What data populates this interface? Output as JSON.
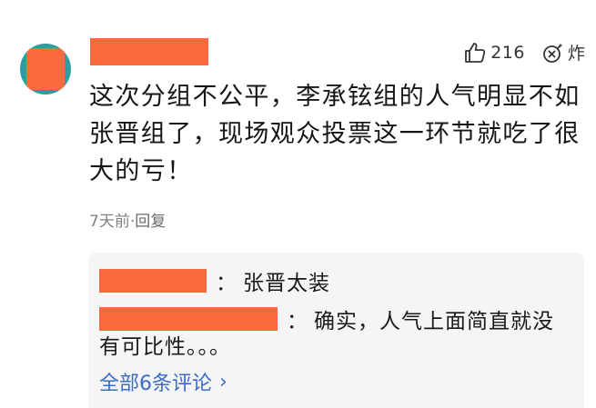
{
  "comment": {
    "text": "这次分组不公平，李承铉组的人气明显不如张晋组了，现场观众投票这一环节就吃了很大的亏！",
    "likes": "216",
    "bomb_label": "炸",
    "time": "7天前",
    "separator": "·",
    "reply_label": "回复"
  },
  "replies": [
    {
      "text": "张晋太装"
    },
    {
      "text_line1": "确实，人气上面简直就没",
      "text_line2": "有可比性。。。"
    }
  ],
  "colon": "：",
  "more_replies_label": "全部6条评论",
  "more_chevron": "›",
  "colors": {
    "redaction": "#fa6a3c",
    "avatar_bg": "#2f9d9d",
    "link": "#3a6cc8",
    "reply_bg": "#f5f5f5"
  }
}
